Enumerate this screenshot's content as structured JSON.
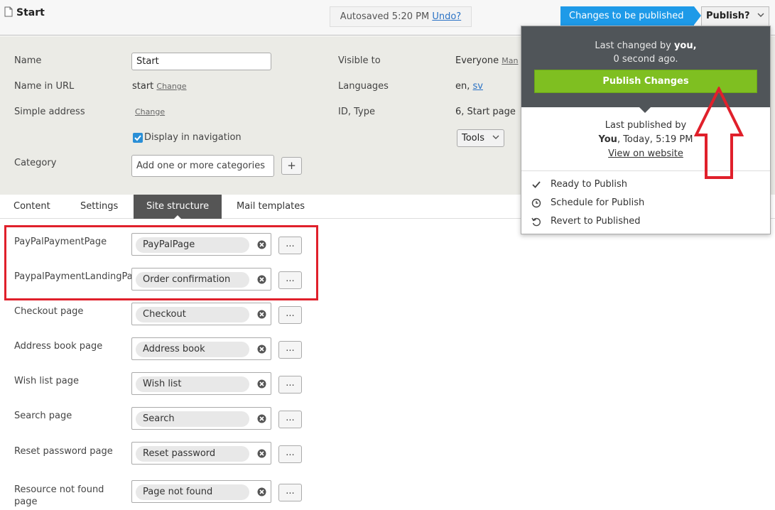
{
  "header": {
    "title": "Start",
    "autosave_text": "Autosaved 5:20 PM",
    "undo_label": "Undo?",
    "changes_badge": "Changes to be published",
    "publish_button": "Publish?"
  },
  "properties": {
    "name_label": "Name",
    "name_value": "Start",
    "name_in_url_label": "Name in URL",
    "name_in_url_value": "start",
    "change_link": "Change",
    "simple_address_label": "Simple address",
    "display_in_nav_label": "Display in navigation",
    "category_label": "Category",
    "category_placeholder": "Add one or more categories",
    "plus_label": "+",
    "visible_to_label": "Visible to",
    "visible_to_value": "Everyone",
    "manage_link": "Man",
    "languages_label": "Languages",
    "languages_value": "en,",
    "languages_link": "sv",
    "id_type_label": "ID, Type",
    "id_type_value": "6, Start page",
    "tools_label": "Tools"
  },
  "tabs": [
    {
      "label": "Content"
    },
    {
      "label": "Settings"
    },
    {
      "label": "Site structure"
    },
    {
      "label": "Mail templates"
    }
  ],
  "rows": [
    {
      "label": "PayPalPaymentPage",
      "value": "PayPalPage"
    },
    {
      "label": "PaypalPaymentLandingPage",
      "value": "Order confirmation"
    },
    {
      "label": "Checkout page",
      "value": "Checkout"
    },
    {
      "label": "Address book page",
      "value": "Address book"
    },
    {
      "label": "Wish list page",
      "value": "Wish list"
    },
    {
      "label": "Search page",
      "value": "Search"
    },
    {
      "label": "Reset password page",
      "value": "Reset password"
    },
    {
      "label": "Resource not found page",
      "value": "Page not found"
    }
  ],
  "dots_label": "...",
  "dropdown": {
    "last_changed_prefix": "Last changed by",
    "last_changed_user": "you,",
    "last_changed_time": "0 second ago.",
    "publish_changes": "Publish Changes",
    "last_published_label": "Last published by",
    "last_published_user": "You",
    "last_published_time": ", Today, 5:19 PM",
    "view_on_website": "View on website",
    "items": [
      {
        "label": "Ready to Publish",
        "icon": "check-icon"
      },
      {
        "label": "Schedule for Publish",
        "icon": "clock-icon"
      },
      {
        "label": "Revert to Published",
        "icon": "revert-icon"
      }
    ]
  },
  "colors": {
    "accent_blue": "#1e9ae8",
    "publish_green": "#7fbf21",
    "highlight_red": "#e0202b",
    "dropdown_dark": "#505559"
  }
}
